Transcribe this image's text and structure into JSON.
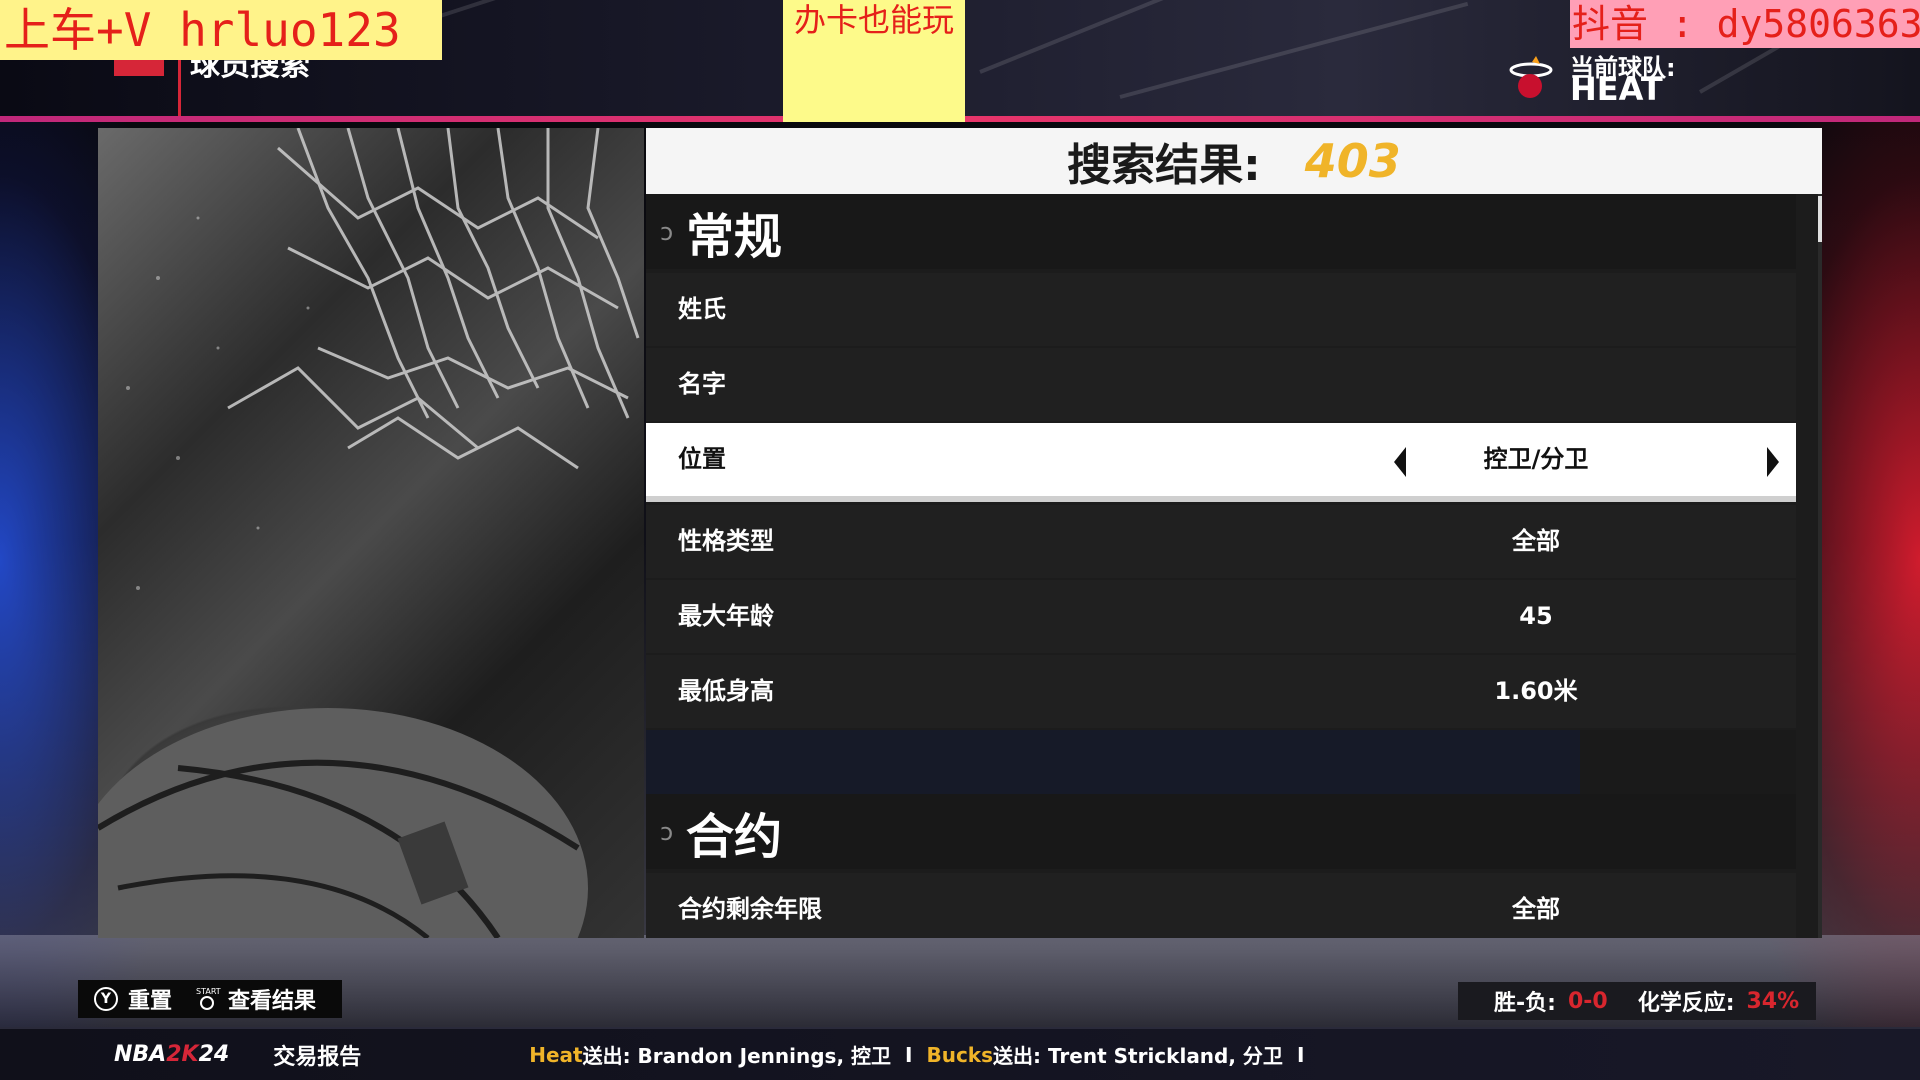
{
  "overlays": {
    "left": "上车+V  hrluo123",
    "middle": "办卡也能玩",
    "right": "抖音 : dy5806363"
  },
  "header": {
    "page_title": "球员搜索",
    "current_team_label": "当前球队:",
    "current_team_name": "HEAT"
  },
  "search": {
    "result_label": "搜索结果:",
    "result_count": "403"
  },
  "sections": [
    {
      "title": "常规",
      "rows": [
        {
          "label": "姓氏",
          "value": ""
        },
        {
          "label": "名字",
          "value": ""
        },
        {
          "label": "位置",
          "value": "控卫/分卫",
          "selected": true
        },
        {
          "label": "性格类型",
          "value": "全部"
        },
        {
          "label": "最大年龄",
          "value": "45"
        },
        {
          "label": "最低身高",
          "value": "1.60米"
        }
      ]
    },
    {
      "title": "合约",
      "rows": [
        {
          "label": "合约剩余年限",
          "value": "全部"
        }
      ]
    }
  ],
  "controls": {
    "reset_label": "重置",
    "view_results_label": "查看结果",
    "y_button": "Y",
    "start_button": "START"
  },
  "stats": {
    "record_label": "胜-负:",
    "record_value": "0-0",
    "chemistry_label": "化学反应:",
    "chemistry_value": "34%"
  },
  "ticker": {
    "logo_nba": "NBA",
    "logo_2k": "2K",
    "logo_year": "24",
    "title": "交易报告",
    "trades": [
      {
        "team": "Heat",
        "verb": "送出:",
        "detail": "Brandon Jennings, 控卫"
      },
      {
        "team": "Bucks",
        "verb": "送出:",
        "detail": "Trent Strickland, 分卫"
      }
    ],
    "separator": "I"
  },
  "colors": {
    "accent_gold": "#f0b429",
    "accent_red": "#d62638",
    "selected_row_bg": "#ffffff",
    "row_bg": "#202020"
  }
}
